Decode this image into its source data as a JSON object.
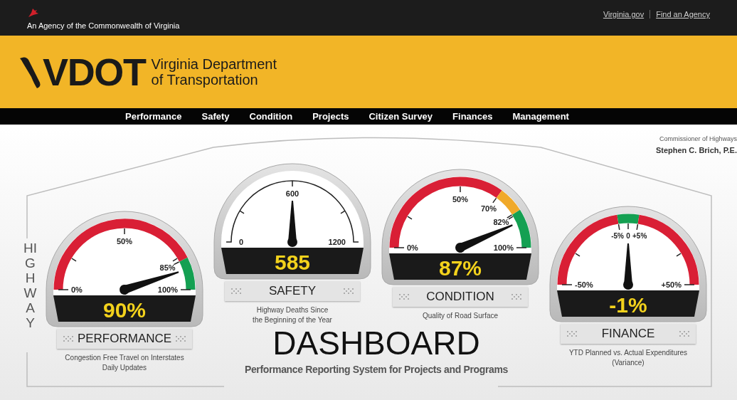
{
  "top_bar": {
    "agency": "An Agency of the Commonwealth of Virginia",
    "links": [
      "Virginia.gov",
      "Find an Agency"
    ]
  },
  "header": {
    "logo": "VDOT",
    "org_name_lines": [
      "Virginia Department",
      "of Transportation"
    ]
  },
  "nav": [
    "Performance",
    "Safety",
    "Condition",
    "Projects",
    "Citizen Survey",
    "Finances",
    "Management"
  ],
  "commissioner": {
    "title": "Commissioner of Highways",
    "name": "Stephen C. Brich, P.E."
  },
  "side_label": "HIGHWAY",
  "gauges": [
    {
      "kind": "target",
      "ticks": [
        "0%",
        "50%",
        "85%",
        "100%"
      ],
      "bands": [
        {
          "color": "#d91f35"
        },
        {
          "color": "#14a052"
        }
      ],
      "reading": "90%",
      "label": "PERFORMANCE",
      "caption_lines": [
        "Congestion Free Travel on Interstates",
        "Daily Updates"
      ]
    },
    {
      "kind": "count",
      "ticks": [
        "0",
        "600",
        "1200"
      ],
      "reading": "585",
      "label": "SAFETY",
      "caption_lines": [
        "Highway Deaths Since",
        "the Beginning of the Year"
      ]
    },
    {
      "kind": "zones",
      "ticks": [
        "0%",
        "50%",
        "70%",
        "82%",
        "100%"
      ],
      "bands": [
        {
          "color": "#d91f35"
        },
        {
          "color": "#f0a92a"
        },
        {
          "color": "#14a052"
        }
      ],
      "reading": "87%",
      "label": "CONDITION",
      "caption_lines": [
        "Quality of Road Surface"
      ]
    },
    {
      "kind": "variance",
      "ticks": [
        "-50%",
        "-5%",
        "0",
        "+5%",
        "+50%"
      ],
      "bands": [
        {
          "color": "#d91f35"
        },
        {
          "color": "#14a052"
        },
        {
          "color": "#d91f35"
        }
      ],
      "reading": "-1%",
      "label": "FINANCE",
      "caption_lines": [
        "YTD Planned vs. Actual Expenditures",
        "(Variance)"
      ]
    }
  ],
  "title": "DASHBOARD",
  "subtitle": "Performance Reporting System for Projects and Programs"
}
